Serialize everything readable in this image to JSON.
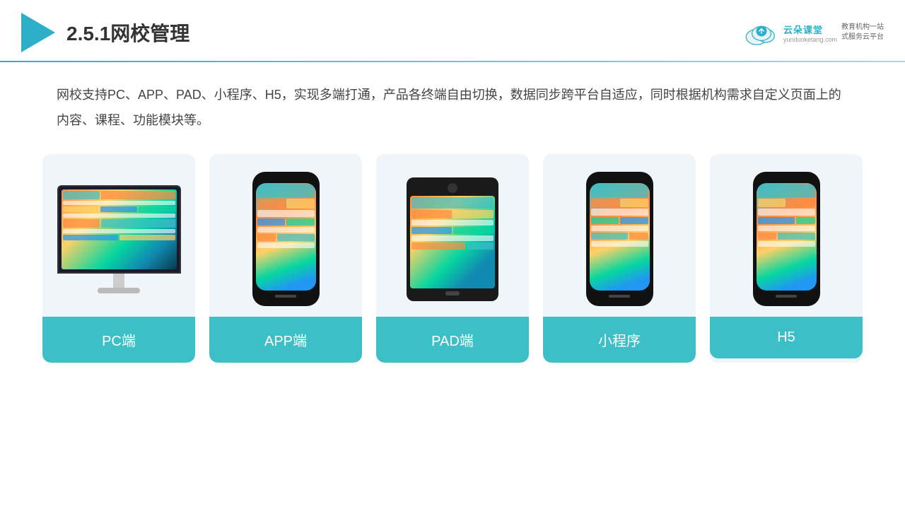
{
  "header": {
    "title": "2.5.1网校管理",
    "brand_name": "云朵课堂",
    "brand_url": "yunduoketang.com",
    "brand_slogan": "教育机构一站\n式服务云平台"
  },
  "description": {
    "text": "网校支持PC、APP、PAD、小程序、H5，实现多端打通，产品各终端自由切换，数据同步跨平台自适应，同时根据机构需求自定义页面上的内容、课程、功能模块等。"
  },
  "cards": [
    {
      "id": "pc",
      "label": "PC端"
    },
    {
      "id": "app",
      "label": "APP端"
    },
    {
      "id": "pad",
      "label": "PAD端"
    },
    {
      "id": "miniapp",
      "label": "小程序"
    },
    {
      "id": "h5",
      "label": "H5"
    }
  ],
  "colors": {
    "accent": "#3dbfc8",
    "header_line": "#2bb0c8",
    "text_main": "#444444",
    "card_bg": "#f0f5fa"
  }
}
